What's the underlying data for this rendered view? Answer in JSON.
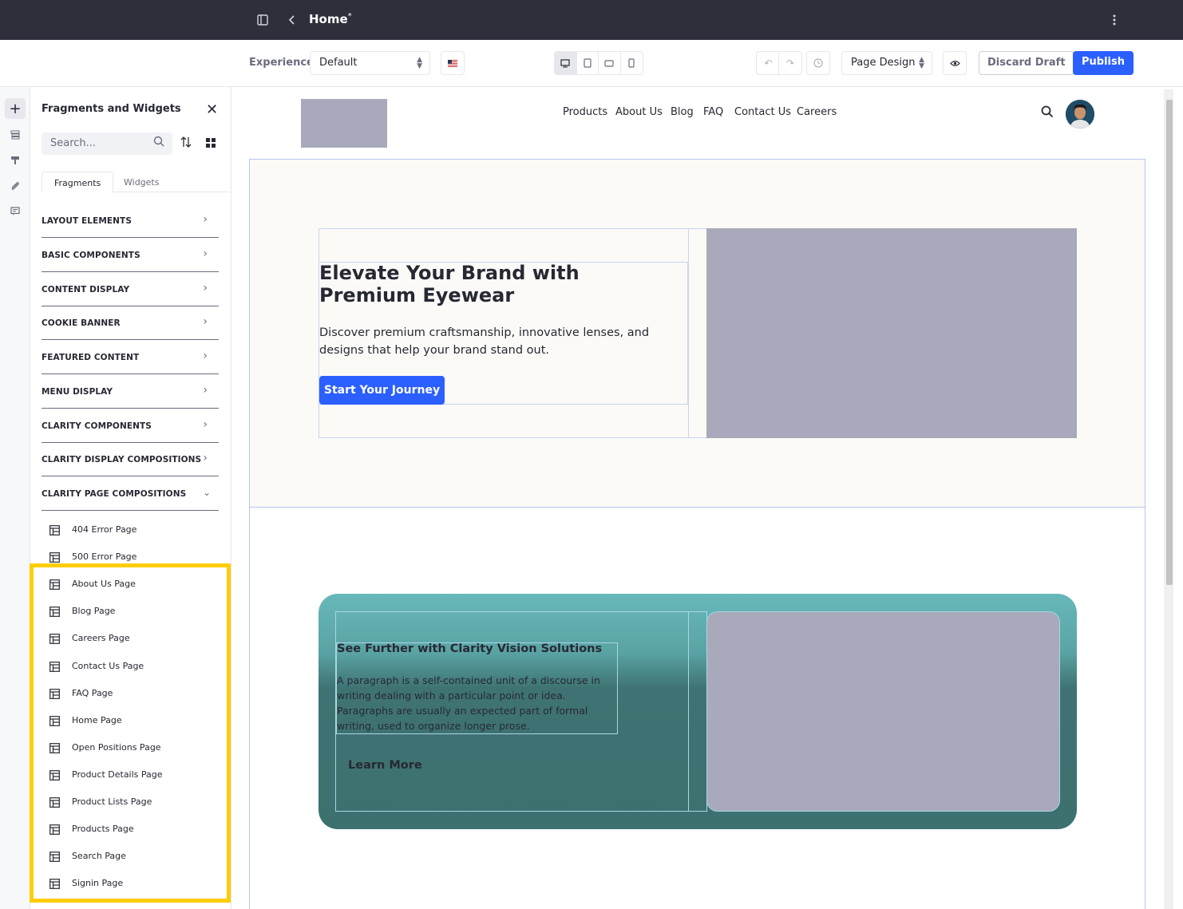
{
  "topbar": {
    "title": "Home",
    "modified_marker": "*",
    "icons": [
      "sidebar-toggle-icon",
      "back-chevron-icon",
      "kebab-menu-icon"
    ]
  },
  "toolbar": {
    "experience_label": "Experience",
    "experience_value": "Default",
    "language_flag": "en-US",
    "devices": [
      "desktop",
      "tablet",
      "landscape-phone",
      "portrait-phone"
    ],
    "active_device": "desktop",
    "page_design_value": "Page Design",
    "discard_label": "Discard Draft",
    "publish_label": "Publish"
  },
  "rail": {
    "items": [
      "add-icon",
      "browser-icon",
      "paint-brush-icon",
      "paperclip-icon",
      "comments-icon"
    ]
  },
  "panel": {
    "title": "Fragments and Widgets",
    "search_placeholder": "Search...",
    "tabs": [
      "Fragments",
      "Widgets"
    ],
    "active_tab": "Fragments",
    "categories": [
      {
        "label": "LAYOUT ELEMENTS",
        "expanded": false
      },
      {
        "label": "BASIC COMPONENTS",
        "expanded": false
      },
      {
        "label": "CONTENT DISPLAY",
        "expanded": false
      },
      {
        "label": "COOKIE BANNER",
        "expanded": false
      },
      {
        "label": "FEATURED CONTENT",
        "expanded": false
      },
      {
        "label": "MENU DISPLAY",
        "expanded": false
      },
      {
        "label": "CLARITY COMPONENTS",
        "expanded": false
      },
      {
        "label": "CLARITY DISPLAY COMPOSITIONS",
        "expanded": false
      },
      {
        "label": "CLARITY PAGE COMPOSITIONS",
        "expanded": true
      }
    ],
    "page_compositions": [
      "404 Error Page",
      "500 Error Page",
      "About Us Page",
      "Blog Page",
      "Careers Page",
      "Contact Us Page",
      "FAQ Page",
      "Home Page",
      "Open Positions Page",
      "Product Details Page",
      "Product Lists Page",
      "Products Page",
      "Search Page",
      "Signin Page"
    ],
    "highlight_color": "#ffcd08"
  },
  "site": {
    "nav": [
      "Products",
      "About Us",
      "Blog",
      "FAQ",
      "Contact Us",
      "Careers"
    ],
    "hero": {
      "title": "Elevate Your Brand with Premium Eyewear",
      "text": "Discover premium craftsmanship, innovative lenses, and designs that help your brand stand out.",
      "button": "Start Your Journey"
    },
    "feature": {
      "title": "See Further with Clarity Vision Solutions",
      "text": "A paragraph is a self-contained unit of a discourse in writing dealing with a particular point or idea. Paragraphs are usually an expected part of formal writing, used to organize longer prose.",
      "link": "Learn More"
    }
  },
  "colors": {
    "topbar": "#2d2f3b",
    "primary": "#2b5fff",
    "placeholder": "#a8a9ba",
    "teal": "#3f7373"
  }
}
